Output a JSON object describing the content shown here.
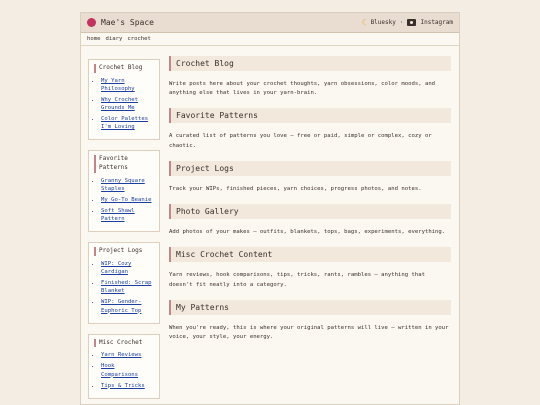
{
  "site": {
    "title": "Mae's Space"
  },
  "header": {
    "bluesky": "Bluesky",
    "separator": "·",
    "instagram": "Instagram"
  },
  "nav": [
    "home",
    "diary",
    "crochet"
  ],
  "sidebar": [
    {
      "title": "Crochet Blog",
      "links": [
        "My Yarn Philosophy",
        "Why Crochet Grounds Me",
        "Color Palettes I'm Loving"
      ]
    },
    {
      "title": "Favorite Patterns",
      "links": [
        "Granny Square Staples",
        "My Go-To Beanie",
        "Soft Shawl Pattern"
      ]
    },
    {
      "title": "Project Logs",
      "links": [
        "WIP: Cozy Cardigan",
        "Finished: Scrap Blanket",
        "WIP: Gender-Euphoric Top"
      ]
    },
    {
      "title": "Misc Crochet",
      "links": [
        "Yarn Reviews",
        "Hook Comparisons",
        "Tips & Tricks"
      ]
    }
  ],
  "sections": [
    {
      "title": "Crochet Blog",
      "text": "Write posts here about your crochet thoughts, yarn obsessions, color moods, and anything else that lives in your yarn-brain."
    },
    {
      "title": "Favorite Patterns",
      "text": "A curated list of patterns you love – free or paid, simple or complex, cozy or chaotic."
    },
    {
      "title": "Project Logs",
      "text": "Track your WIPs, finished pieces, yarn choices, progress photos, and notes."
    },
    {
      "title": "Photo Gallery",
      "text": "Add photos of your makes – outfits, blankets, tops, bags, experiments, everything."
    },
    {
      "title": "Misc Crochet Content",
      "text": "Yarn reviews, hook comparisons, tips, tricks, rants, rambles – anything that doesn't fit neatly into a category."
    },
    {
      "title": "My Patterns",
      "text": "When you're ready, this is where your original patterns will live – written in your voice, your style, your energy."
    }
  ],
  "colors": {
    "accent": "#c08888",
    "logo": "#c2335f",
    "link": "#1a3fa0",
    "background": "#f4ede4"
  },
  "icons": {
    "logo": "yarn-ball-icon",
    "bluesky": "moon-icon",
    "instagram": "camera-icon"
  }
}
